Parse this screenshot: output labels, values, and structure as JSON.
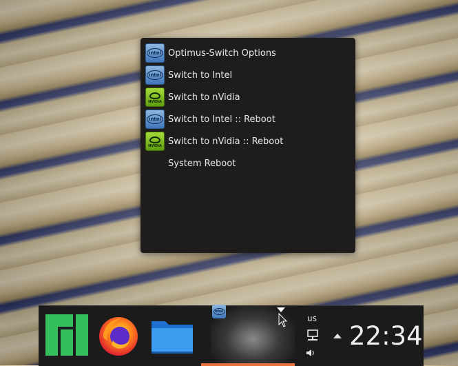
{
  "menu": {
    "items": [
      {
        "label": "Optimus-Switch Options",
        "icon": "intel-icon"
      },
      {
        "label": "Switch to Intel",
        "icon": "intel-icon"
      },
      {
        "label": "Switch to nVidia",
        "icon": "nvidia-icon"
      },
      {
        "label": "Switch to Intel :: Reboot",
        "icon": "intel-icon"
      },
      {
        "label": "Switch to nVidia :: Reboot",
        "icon": "nvidia-icon"
      },
      {
        "label": "System Reboot",
        "icon": ""
      }
    ]
  },
  "icons": {
    "intel_text": "intel",
    "nvidia_text": "NVIDIA"
  },
  "panel": {
    "launchers": [
      "manjaro-icon",
      "firefox-icon",
      "folder-icon"
    ],
    "keyboard_layout": "us",
    "clock": "22:34"
  },
  "colors": {
    "menu_bg": "#1e1d1b",
    "panel_bg": "#1b1b1b",
    "manjaro_green": "#35bf5c",
    "active_indicator": "#e8703a"
  }
}
